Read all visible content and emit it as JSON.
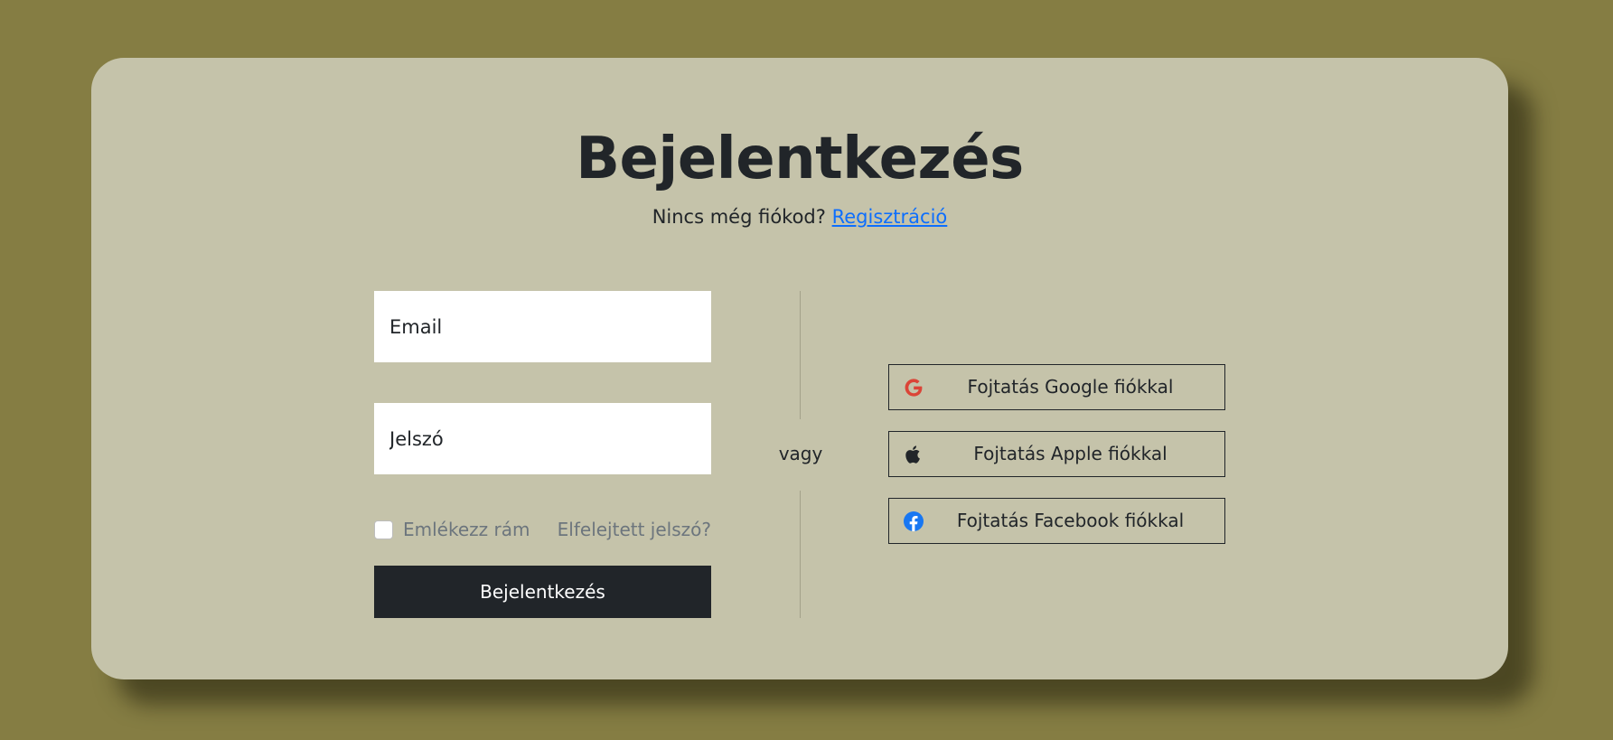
{
  "title": "Bejelentkezés",
  "subtitle": {
    "text": "Nincs még fiókod?",
    "register_link": "Regisztráció"
  },
  "form": {
    "email_placeholder": "Email",
    "password_placeholder": "Jelszó",
    "remember_label": "Emlékezz rám",
    "remember_checked": false,
    "forgot_link": "Elfelejtett jelszó?",
    "submit_label": "Bejelentkezés"
  },
  "divider_text": "vagy",
  "social": {
    "google": {
      "label": "Fojtatás Google fiókkal",
      "icon": "google-icon",
      "color": "#db4437"
    },
    "apple": {
      "label": "Fojtatás Apple fiókkal",
      "icon": "apple-icon",
      "color": "#212529"
    },
    "facebook": {
      "label": "Fojtatás Facebook fiókkal",
      "icon": "facebook-icon",
      "color": "#1877f2"
    }
  },
  "colors": {
    "background": "#857d43",
    "card": "#c5c3aa",
    "primary_button": "#212529",
    "link": "#0d6efd",
    "muted_text": "#6c757d"
  }
}
